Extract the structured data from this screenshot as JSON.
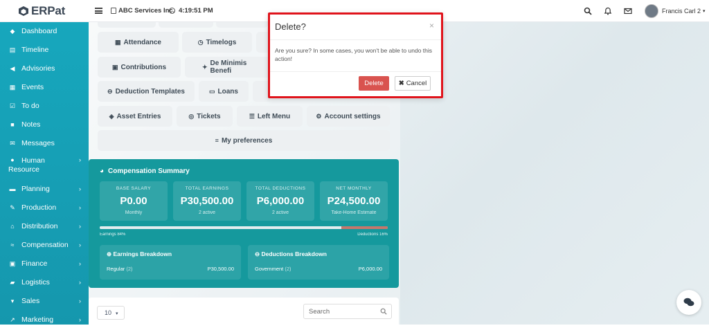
{
  "app": {
    "logo_text": "ERPat"
  },
  "topbar": {
    "company": "ABC Services Inc.",
    "time": "4:19:51 PM",
    "user_name": "Francis Carl 2",
    "icons": [
      "search-icon",
      "bell-icon",
      "mail-icon"
    ]
  },
  "sidebar": {
    "items": [
      {
        "label": "Dashboard",
        "icon": "palette-icon",
        "has_children": false
      },
      {
        "label": "Timeline",
        "icon": "id-card-icon",
        "has_children": false
      },
      {
        "label": "Advisories",
        "icon": "megaphone-icon",
        "has_children": false
      },
      {
        "label": "Events",
        "icon": "calendar-icon",
        "has_children": false
      },
      {
        "label": "To do",
        "icon": "checkbox-icon",
        "has_children": false
      },
      {
        "label": "Notes",
        "icon": "note-icon",
        "has_children": false
      },
      {
        "label": "Messages",
        "icon": "envelope-icon",
        "has_children": false
      },
      {
        "label": "Human",
        "label2": "Resource",
        "icon": "users-icon",
        "has_children": true
      },
      {
        "label": "Planning",
        "icon": "briefcase-icon",
        "has_children": true
      },
      {
        "label": "Production",
        "icon": "tools-icon",
        "has_children": true
      },
      {
        "label": "Distribution",
        "icon": "bank-icon",
        "has_children": true
      },
      {
        "label": "Compensation",
        "icon": "handshake-icon",
        "has_children": true
      },
      {
        "label": "Finance",
        "icon": "money-icon",
        "has_children": true
      },
      {
        "label": "Logistics",
        "icon": "truck-icon",
        "has_children": true
      },
      {
        "label": "Sales",
        "icon": "cart-icon",
        "has_children": true
      },
      {
        "label": "Marketing",
        "icon": "chart-line-icon",
        "has_children": true
      }
    ]
  },
  "shortcuts": {
    "attendance": "Attendance",
    "timelogs": "Timelogs",
    "contributions": "Contributions",
    "de_minimis": "De Minimis Benefi",
    "deduction_templates": "Deduction Templates",
    "loans": "Loans",
    "asset_entries": "Asset Entries",
    "tickets": "Tickets",
    "left_menu": "Left Menu",
    "account_settings": "Account settings",
    "my_preferences": "My preferences"
  },
  "compensation": {
    "title": "Compensation Summary",
    "stats": [
      {
        "label": "BASE SALARY",
        "value": "P0.00",
        "sub": "Monthly"
      },
      {
        "label": "TOTAL EARNINGS",
        "value": "P30,500.00",
        "sub": "2 active"
      },
      {
        "label": "TOTAL DEDUCTIONS",
        "value": "P6,000.00",
        "sub": "2 active"
      },
      {
        "label": "NET MONTHLY",
        "value": "P24,500.00",
        "sub": "Take-Home Estimate"
      }
    ],
    "earnings_pct": 84,
    "earnings_label": "Earnings 84%",
    "deductions_label": "Deductions 16%",
    "earnings_breakdown": {
      "title": "Earnings Breakdown",
      "item": "Regular",
      "count": "(2)",
      "amount": "P30,500.00"
    },
    "deductions_breakdown": {
      "title": "Deductions Breakdown",
      "item": "Government",
      "count": "(2)",
      "amount": "P6,000.00"
    }
  },
  "table_controls": {
    "page_size": "10",
    "search_placeholder": "Search"
  },
  "modal": {
    "title": "Delete?",
    "body": "Are you sure? In some cases, you won't be able to undo this action!",
    "delete_label": "Delete",
    "cancel_label": "Cancel"
  },
  "colors": {
    "sidebar": "#17a7bd",
    "card": "#15999d",
    "danger": "#d9534f",
    "highlight": "#e0131b"
  }
}
